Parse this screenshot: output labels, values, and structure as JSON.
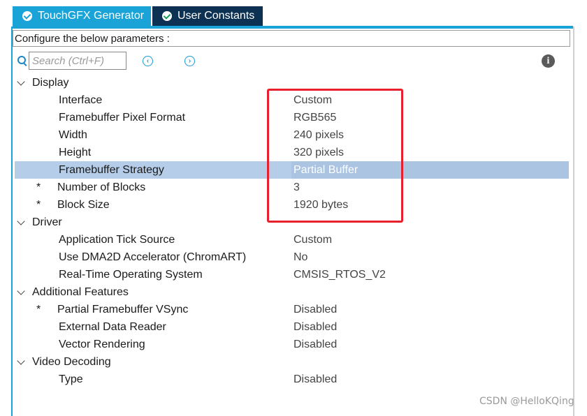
{
  "tabs": [
    {
      "label": "TouchGFX Generator",
      "active": true
    },
    {
      "label": "User Constants",
      "active": false
    }
  ],
  "header": {
    "configure_text": "Configure the below parameters :"
  },
  "search": {
    "placeholder": "Search (Ctrl+F)",
    "value": ""
  },
  "toolbar": {
    "prev_icon": "chevron-left-circle-icon",
    "next_icon": "chevron-right-circle-icon",
    "info_icon": "info-icon"
  },
  "tree": {
    "display": {
      "label": "Display",
      "interface": {
        "label": "Interface",
        "value": "Custom"
      },
      "pixel_format": {
        "label": "Framebuffer Pixel Format",
        "value": "RGB565"
      },
      "width": {
        "label": "Width",
        "value": "240 pixels"
      },
      "height": {
        "label": "Height",
        "value": "320 pixels"
      },
      "strategy": {
        "label": "Framebuffer Strategy",
        "value": "Partial Buffer"
      },
      "blocks": {
        "marker": "*",
        "label": "Number of Blocks",
        "value": "3"
      },
      "block_size": {
        "marker": "*",
        "label": "Block Size",
        "value": "1920 bytes"
      }
    },
    "driver": {
      "label": "Driver",
      "tick": {
        "label": "Application Tick Source",
        "value": "Custom"
      },
      "dma2d": {
        "label": "Use DMA2D Accelerator (ChromART)",
        "value": "No"
      },
      "rtos": {
        "label": "Real-Time Operating System",
        "value": "CMSIS_RTOS_V2"
      }
    },
    "additional": {
      "label": "Additional Features",
      "vsync": {
        "marker": "*",
        "label": "Partial Framebuffer VSync",
        "value": "Disabled"
      },
      "external": {
        "label": "External Data Reader",
        "value": "Disabled"
      },
      "vector": {
        "label": "Vector Rendering",
        "value": "Disabled"
      }
    },
    "video": {
      "label": "Video Decoding",
      "type": {
        "label": "Type",
        "value": "Disabled"
      }
    }
  },
  "watermark": "CSDN @HelloKQing",
  "colors": {
    "tab_active": "#1aa3d6",
    "tab_inactive": "#0d3152",
    "selection": "#b5cde8",
    "highlight": "#e8202e"
  }
}
